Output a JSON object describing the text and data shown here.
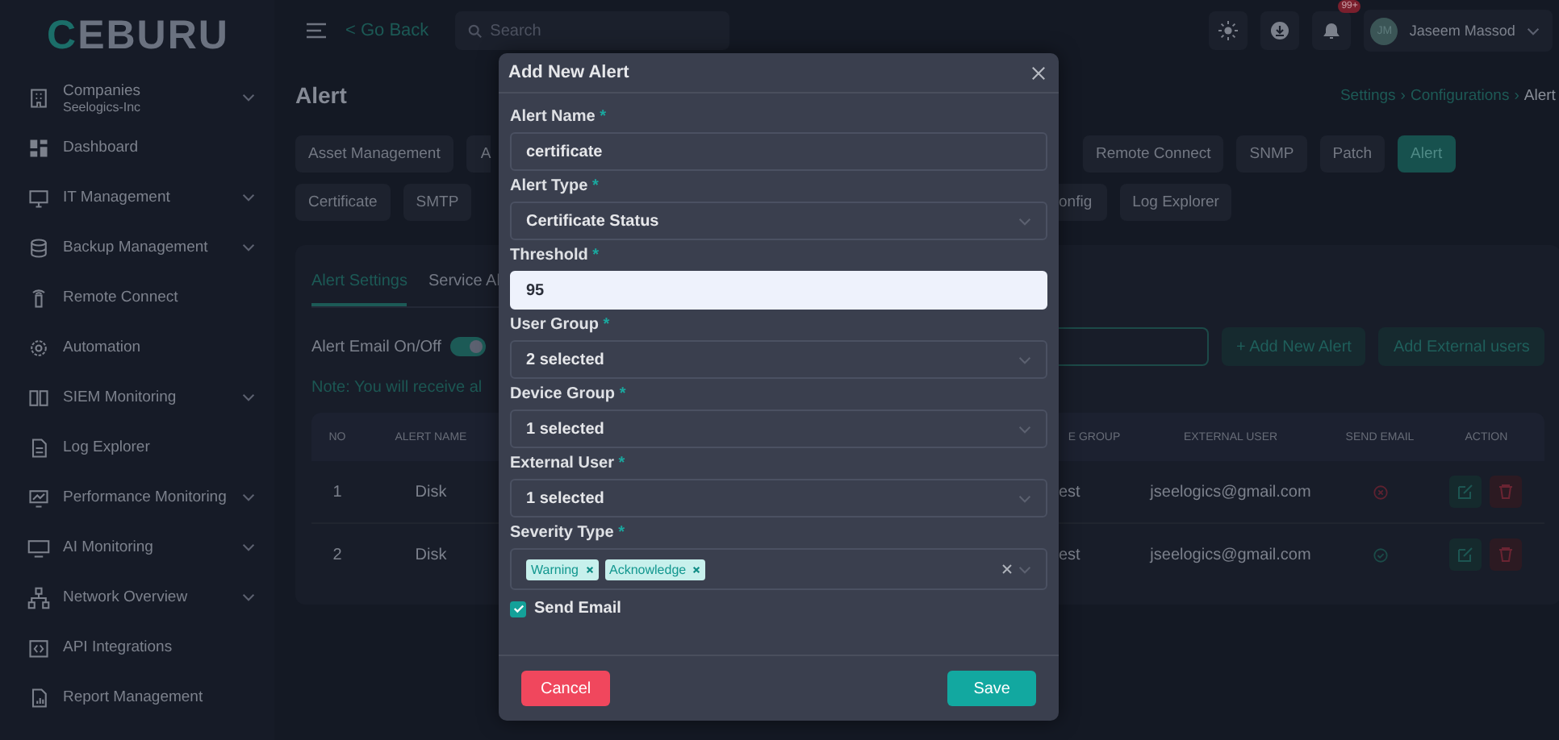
{
  "logo": "CEBURU",
  "topbar": {
    "go_back": "< Go Back",
    "search": {
      "placeholder": "Search"
    },
    "notifications_badge": "99+",
    "user": {
      "initials": "JM",
      "name": "Jaseem Massod"
    }
  },
  "sidebar": {
    "items": [
      {
        "label": "Companies",
        "sublabel": "Seelogics-Inc",
        "kind": "group"
      },
      {
        "label": "Dashboard",
        "kind": "link"
      },
      {
        "label": "IT Management",
        "kind": "group"
      },
      {
        "label": "Backup Management",
        "kind": "group"
      },
      {
        "label": "Remote Connect",
        "kind": "link"
      },
      {
        "label": "Automation",
        "kind": "link"
      },
      {
        "label": "SIEM Monitoring",
        "kind": "group"
      },
      {
        "label": "Log Explorer",
        "kind": "link"
      },
      {
        "label": "Performance Monitoring",
        "kind": "group"
      },
      {
        "label": "AI Monitoring",
        "kind": "group"
      },
      {
        "label": "Network Overview",
        "kind": "group"
      },
      {
        "label": "API Integrations",
        "kind": "link"
      },
      {
        "label": "Report Management",
        "kind": "link"
      }
    ]
  },
  "page": {
    "title": "Alert",
    "breadcrumb_separator": "›",
    "breadcrumb": [
      {
        "label": "Settings",
        "selected": false
      },
      {
        "label": "Configurations",
        "selected": false
      },
      {
        "label": "Alert",
        "selected": true
      }
    ]
  },
  "config_tabs": {
    "row_1_left": [
      {
        "label": "Asset Management",
        "selected": false
      },
      {
        "label": "A",
        "selected": false
      }
    ],
    "row_1_right": [
      {
        "label": "Remote Connect",
        "selected": false
      },
      {
        "label": "SNMP",
        "selected": false
      },
      {
        "label": "Patch",
        "selected": false
      },
      {
        "label": "Alert",
        "selected": true
      }
    ],
    "row_2_left": [
      {
        "label": "Certificate",
        "selected": false
      },
      {
        "label": "SMTP",
        "selected": false
      }
    ],
    "row_2_right": [
      {
        "label": "onfig",
        "selected": false
      },
      {
        "label": "Log Explorer",
        "selected": false
      }
    ]
  },
  "card": {
    "tabs": [
      {
        "label": "Alert Settings",
        "selected": true
      },
      {
        "label": "Service Al",
        "selected": false
      }
    ],
    "email_toggle": {
      "label": "Alert Email On/Off",
      "on": true
    },
    "buttons": [
      "+ Add New Alert",
      "Add External users"
    ],
    "note": "Note: You will receive al",
    "table": {
      "columns": [
        "NO",
        "ALERT NAME",
        "E GROUP",
        "EXTERNAL USER",
        "SEND EMAIL",
        "ACTION"
      ],
      "rows": [
        {
          "no": "1",
          "alert_name": "Disk",
          "column_3": "est",
          "external_user": "jseelogics@gmail.com",
          "send_email": false
        },
        {
          "no": "2",
          "alert_name": "Disk",
          "column_3": "est",
          "external_user": "jseelogics@gmail.com",
          "send_email": true
        }
      ]
    }
  },
  "modal": {
    "title": "Add New Alert",
    "fields": [
      {
        "kind": "text",
        "label": "Alert Name",
        "mark": "*",
        "value": "certificate",
        "focused": false
      },
      {
        "kind": "select",
        "label": "Alert Type",
        "mark": "*",
        "value": "Certificate Status"
      },
      {
        "kind": "text",
        "label": "Threshold",
        "mark": "*",
        "value": "95",
        "focused": true
      },
      {
        "kind": "select",
        "label": "User Group",
        "mark": "*",
        "value": "2 selected"
      },
      {
        "kind": "select",
        "label": "Device Group",
        "mark": "*",
        "value": "1 selected"
      },
      {
        "kind": "select",
        "label": "External User",
        "mark": "*",
        "value": "1 selected"
      },
      {
        "kind": "multiselect",
        "label": "Severity Type",
        "mark": "*",
        "tags": [
          "Warning",
          "Acknowledge"
        ]
      }
    ],
    "send_email": {
      "label": "Send Email",
      "checked": true
    },
    "cancel": "Cancel",
    "save": "Save"
  }
}
